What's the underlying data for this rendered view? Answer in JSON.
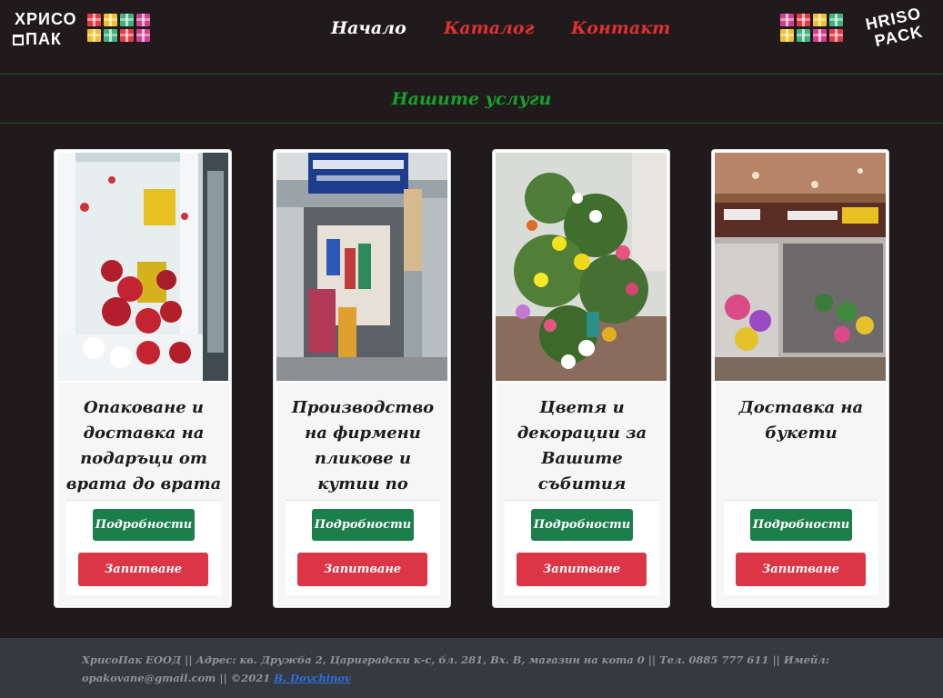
{
  "header": {
    "logo_left": {
      "line1": "ХРИСО",
      "line2": "ПАК"
    },
    "logo_right": {
      "line1": "HRISO",
      "line2": "PACK"
    },
    "nav": [
      {
        "label": "Начало",
        "color": "#ffffff"
      },
      {
        "label": "Каталог",
        "color": "#e03131"
      },
      {
        "label": "Контакт",
        "color": "#e03131"
      }
    ],
    "gift_colors": [
      "#e63946",
      "#f2c02a",
      "#3fb37f",
      "#d33f8f",
      "#f2c02a",
      "#3fb37f",
      "#e63946",
      "#d33f8f"
    ]
  },
  "section": {
    "title": "Нашите услуги"
  },
  "cards": [
    {
      "title": "Опаковане и доставка на подаръци от врата до врата",
      "details_label": "Подробности",
      "inquiry_label": "Запитване"
    },
    {
      "title": "Производство на фирмени пликове и кутии по поръчка",
      "details_label": "Подробности",
      "inquiry_label": "Запитване"
    },
    {
      "title": "Цветя и декорации за Вашите събития",
      "details_label": "Подробности",
      "inquiry_label": "Запитване"
    },
    {
      "title": "Доставка на букети",
      "details_label": "Подробности",
      "inquiry_label": "Запитване"
    }
  ],
  "footer": {
    "text": "ХрисоПак ЕООД || Адрес: кв. Дружба 2, Цариградски к-с, бл. 281, Вх. В, магазин на кота 0 || Тел. 0885 777 611 || Имейл: opakovane@gmail.com || ©2021",
    "link": "B. Doychinov"
  },
  "colors": {
    "background": "#211a1d",
    "accent_green": "#17a12a",
    "nav_red": "#e03131",
    "details_button": "#1a7f4a",
    "inquiry_button": "#dc3545",
    "footer_bg": "#343a40"
  }
}
